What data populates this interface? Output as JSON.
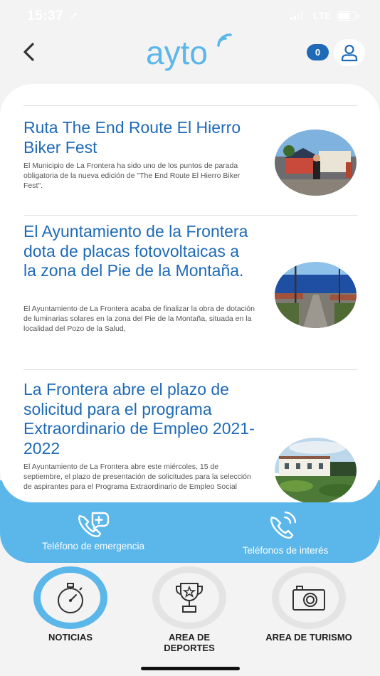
{
  "status_bar": {
    "time": "15:37",
    "network": "LTE"
  },
  "header": {
    "logo_text": "ayto",
    "notification_count": "0"
  },
  "articles": [
    {
      "title": "Ruta The End Route El Hierro Biker Fest",
      "summary": "El Municipio de La Frontera ha sido uno de los puntos de parada obligatoria de la nueva edición de \"The End Route El Hierro Biker Fest\"."
    },
    {
      "title": "El Ayuntamiento de la Frontera dota de placas fotovoltaicas a la zona del Pie de la Montaña.",
      "summary": "El Ayuntamiento de La Frontera acaba de finalizar la obra de dotación de luminarias solares en la zona del Pie de la Montaña, situada en la localidad del Pozo de la Salud,"
    },
    {
      "title": "La Frontera abre el plazo de solicitud para el programa Extraordinario de Empleo 2021-2022",
      "summary": "El Ayuntamiento de La Frontera abre este miércoles, 15 de septiembre, el plazo de presentación de solicitudes para la selección de aspirantes para el Programa Extraordinario de Empleo Social"
    }
  ],
  "quick_links": {
    "emergency_label": "Teléfono de emergencia",
    "interest_label": "Teléfonos de interés"
  },
  "tabs": [
    {
      "label": "NOTICIAS",
      "icon": "stopwatch-icon",
      "active": true
    },
    {
      "label": "AREA DE DEPORTES",
      "icon": "trophy-icon",
      "active": false
    },
    {
      "label": "AREA DE TURISMO",
      "icon": "camera-icon",
      "active": false
    }
  ],
  "colors": {
    "brand_blue": "#1e6ab7",
    "accent_light_blue": "#5bb7ea",
    "background": "#f3f3f3"
  }
}
